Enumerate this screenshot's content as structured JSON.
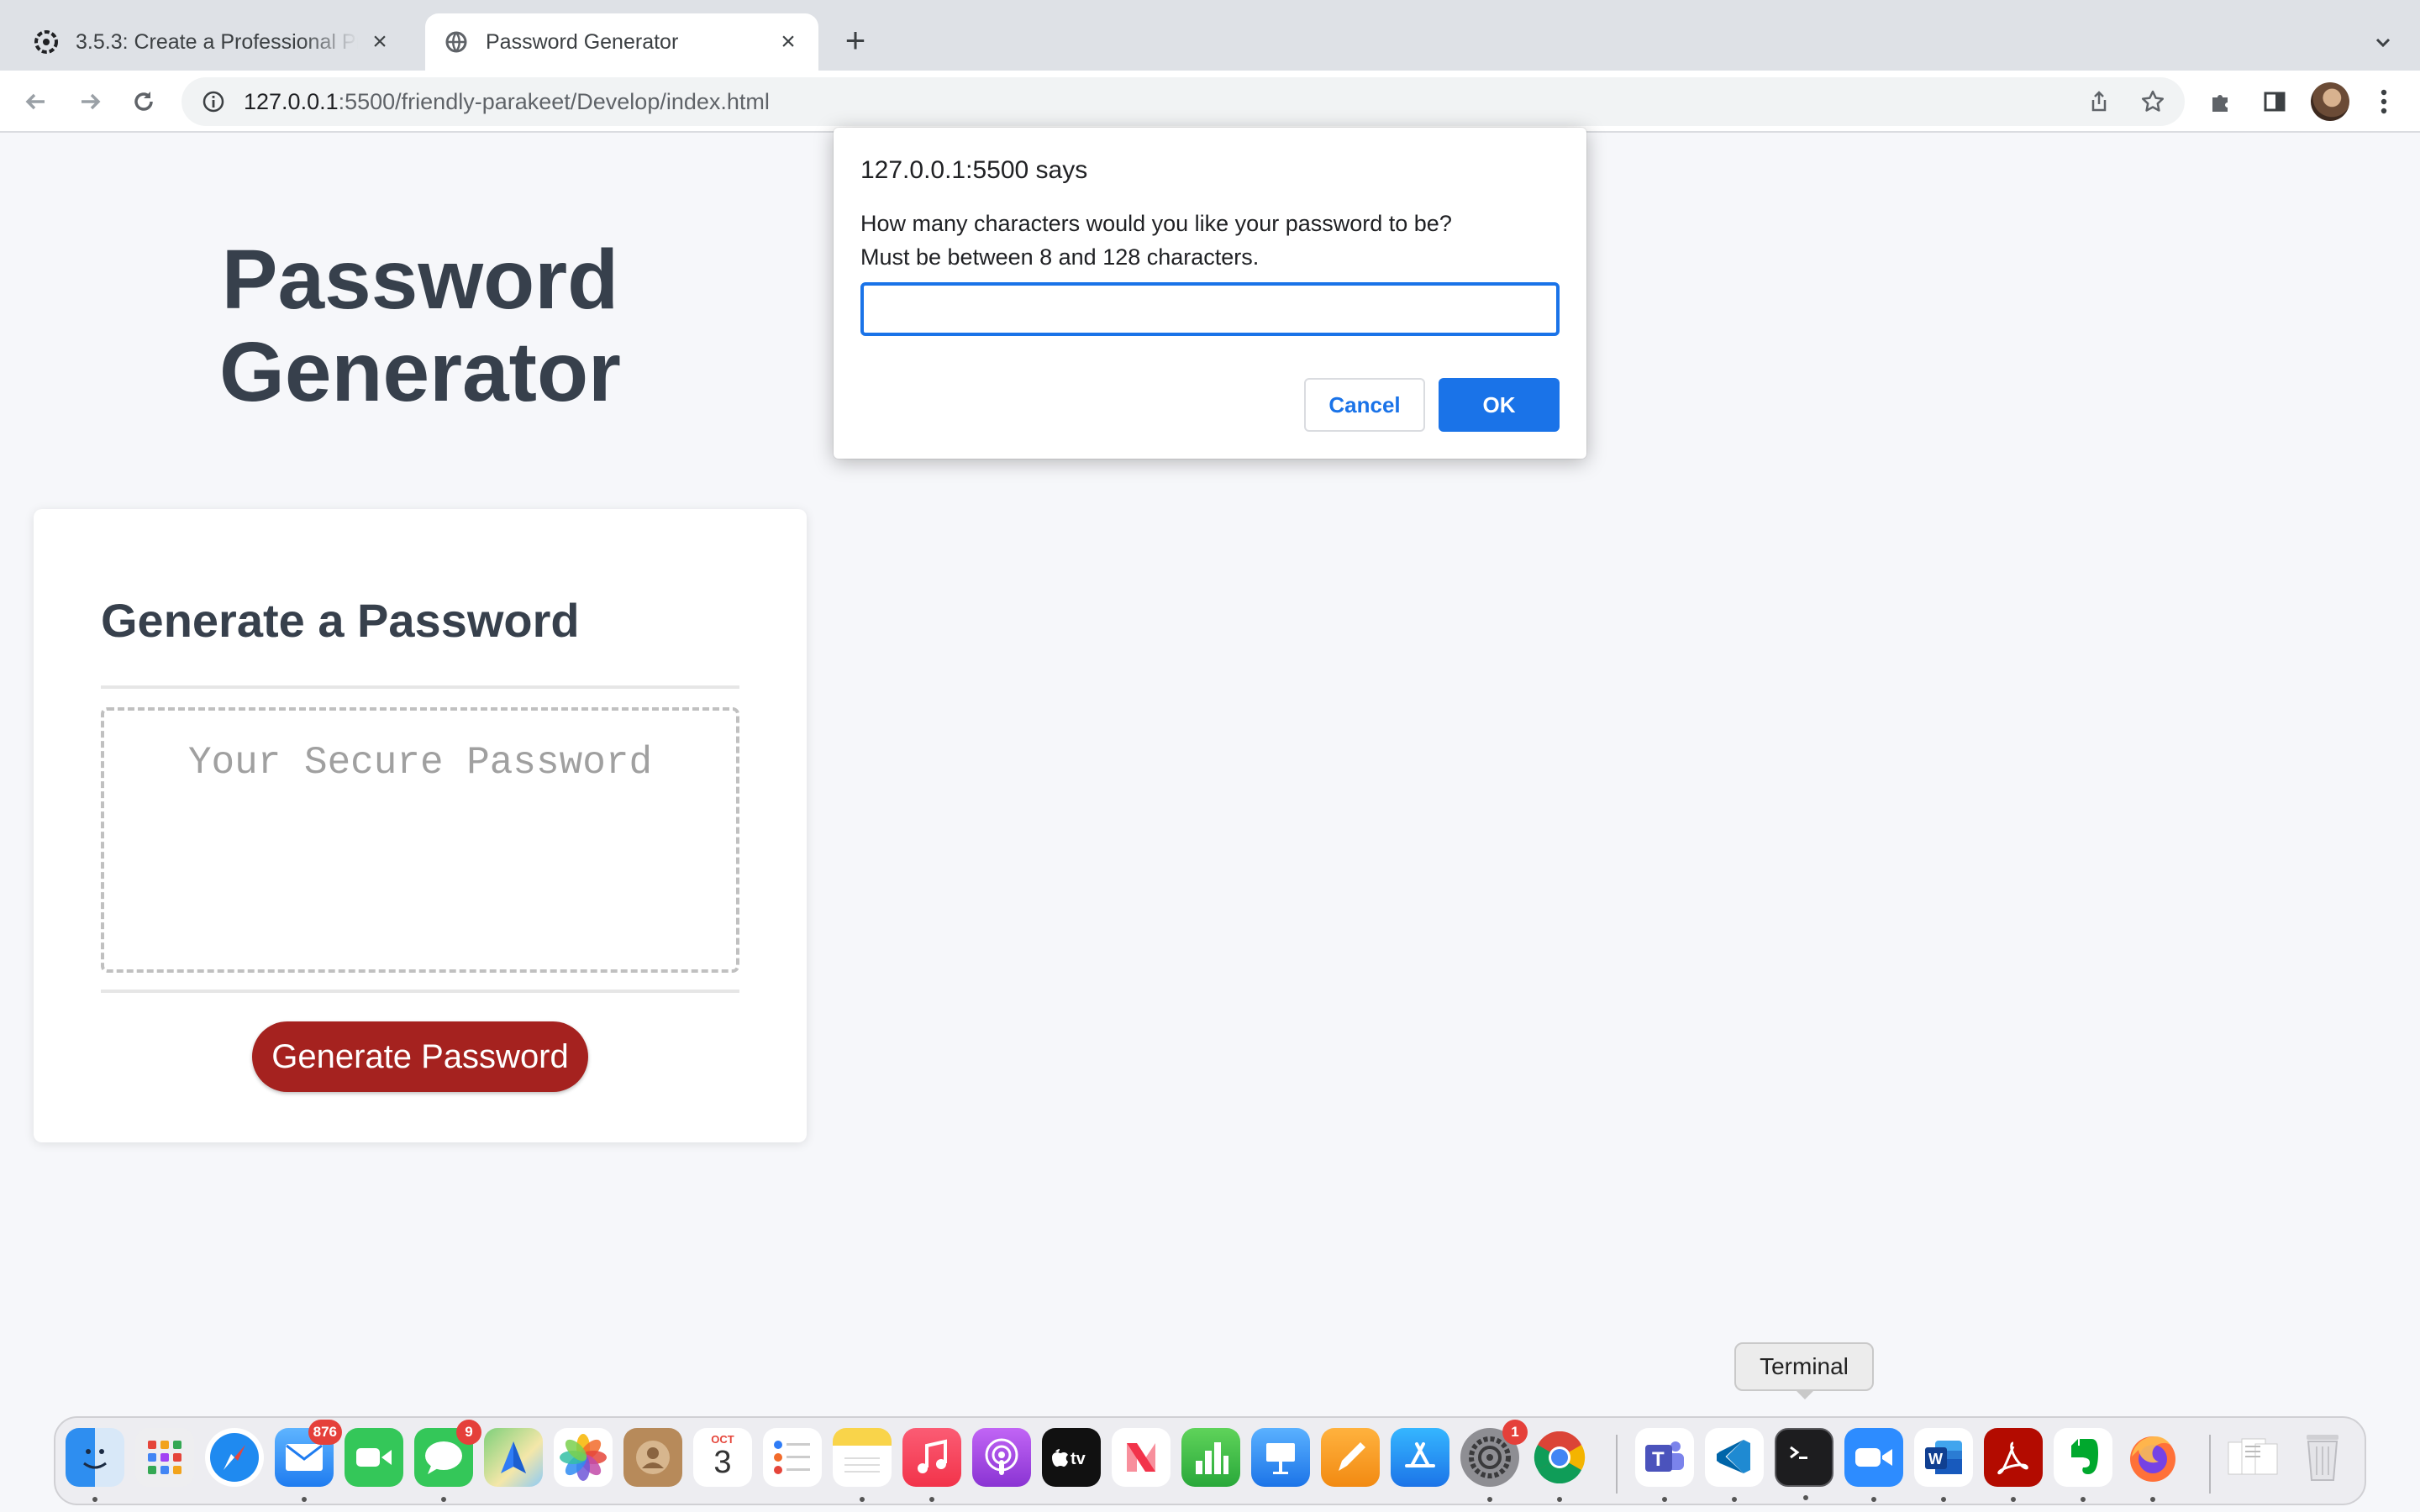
{
  "browser": {
    "tabs": [
      {
        "title": "3.5.3: Create a Professional Pr",
        "icon": "canvas-logo-icon",
        "active": false
      },
      {
        "title": "Password Generator",
        "icon": "globe-icon",
        "active": true
      }
    ],
    "url_host": "127.0.0.1",
    "url_rest": ":5500/friendly-parakeet/Develop/index.html"
  },
  "page": {
    "title_line1": "Password",
    "title_line2": "Generator",
    "card_heading": "Generate a Password",
    "password_placeholder": "Your Secure Password",
    "generate_button": "Generate Password"
  },
  "dialog": {
    "title": "127.0.0.1:5500 says",
    "message_line1": "How many characters would you like your password to be?",
    "message_line2": "Must be between 8 and 128 characters.",
    "input_value": "",
    "cancel_label": "Cancel",
    "ok_label": "OK"
  },
  "dock": {
    "tooltip": "Terminal",
    "badges": {
      "mail": "876",
      "messages": "9",
      "system_settings": "1"
    },
    "calendar_month": "OCT",
    "calendar_day": "3",
    "apps": [
      "Finder",
      "Launchpad",
      "Safari",
      "Mail",
      "FaceTime",
      "Messages",
      "Maps",
      "Photos",
      "Contacts",
      "Calendar",
      "Reminders",
      "Notes",
      "Music",
      "Podcasts",
      "TV",
      "News",
      "Numbers",
      "Keynote",
      "Pages",
      "App Store",
      "System Settings",
      "Chrome",
      "Teams",
      "VS Code",
      "Terminal",
      "Zoom",
      "Word",
      "Acrobat",
      "Evernote",
      "Firefox",
      "Documents",
      "Trash"
    ]
  },
  "colors": {
    "accent_red": "#a5221f",
    "heading": "#37404c",
    "chrome_blue": "#1a73e8"
  }
}
